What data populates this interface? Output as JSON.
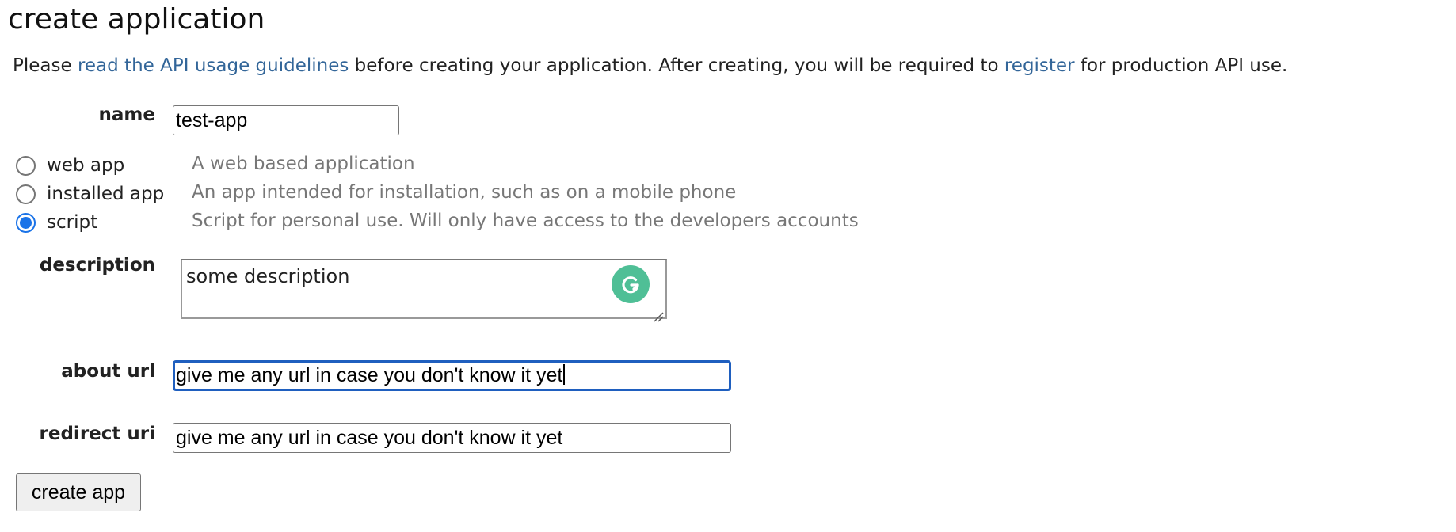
{
  "page": {
    "title": "create application",
    "intro": {
      "prefix": "Please ",
      "guidelines_link": "read the API usage guidelines",
      "middle": " before creating your application. After creating, you will be required to ",
      "register_link": "register",
      "suffix": " for production API use."
    }
  },
  "form": {
    "name": {
      "label": "name",
      "value": "test-app"
    },
    "app_type": {
      "options": [
        {
          "label": "web app",
          "description": "A web based application",
          "checked": false
        },
        {
          "label": "installed app",
          "description": "An app intended for installation, such as on a mobile phone",
          "checked": false
        },
        {
          "label": "script",
          "description": "Script for personal use. Will only have access to the developers accounts",
          "checked": true
        }
      ]
    },
    "description": {
      "label": "description",
      "value": "some description"
    },
    "about_url": {
      "label": "about url",
      "value": "give me any url in case you don't know it yet"
    },
    "redirect_uri": {
      "label": "redirect uri",
      "value": "give me any url in case you don't know it yet"
    },
    "submit_label": "create app"
  },
  "colors": {
    "link": "#336699",
    "focus_ring": "#1f5fbf",
    "radio_checked": "#1a73e8",
    "grammarly": "#4fbf96",
    "muted_text": "#777777"
  },
  "icons": {
    "grammarly": "grammarly-icon",
    "resize": "resize-grip-icon"
  }
}
